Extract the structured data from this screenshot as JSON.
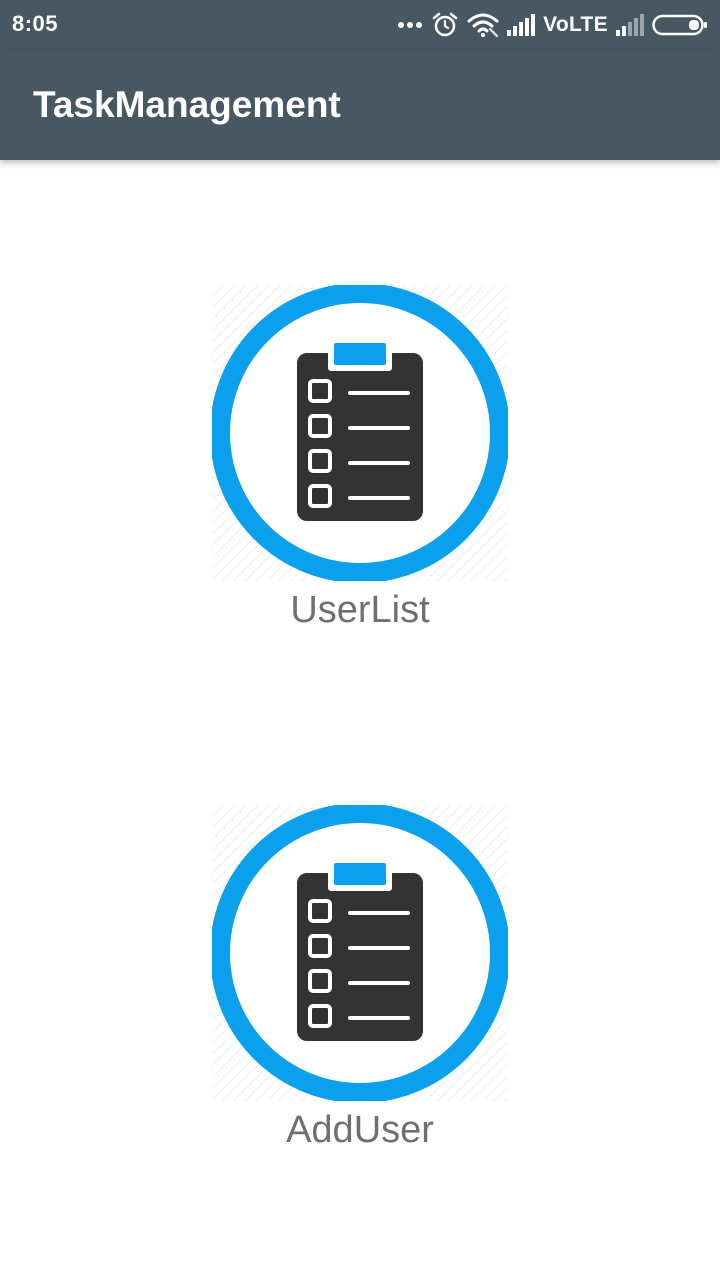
{
  "status_bar": {
    "time": "8:05",
    "network_label": "VoLTE",
    "icons": [
      "more-dots-icon",
      "alarm-icon",
      "wifi-icon",
      "signal-icon",
      "signal-weak-icon",
      "battery-icon"
    ]
  },
  "app_bar": {
    "title": "TaskManagement"
  },
  "tiles": [
    {
      "label": "UserList",
      "icon": "clipboard-checklist-icon"
    },
    {
      "label": "AddUser",
      "icon": "clipboard-checklist-icon"
    }
  ],
  "colors": {
    "toolbar": "#485863",
    "accent_ring": "#0AA0EE",
    "clipboard": "#333333",
    "label_text": "#6F6F6F"
  }
}
